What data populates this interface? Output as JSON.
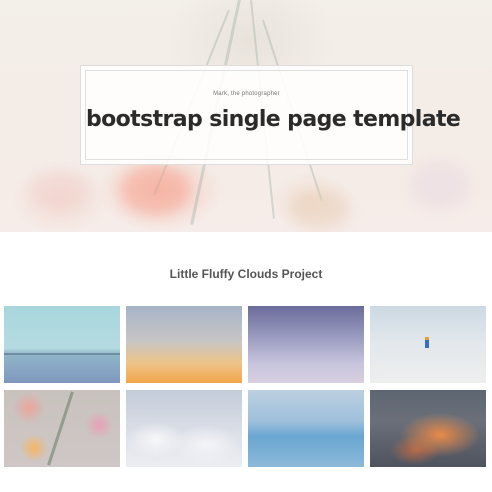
{
  "hero": {
    "tagline": "Mark, the photographer",
    "title": "bootstrap single page template"
  },
  "gallery": {
    "title": "Little Fluffy Clouds Project"
  },
  "colors": {
    "title_text": "#2b2b2b",
    "section_title": "#555555",
    "background": "#ffffff"
  }
}
